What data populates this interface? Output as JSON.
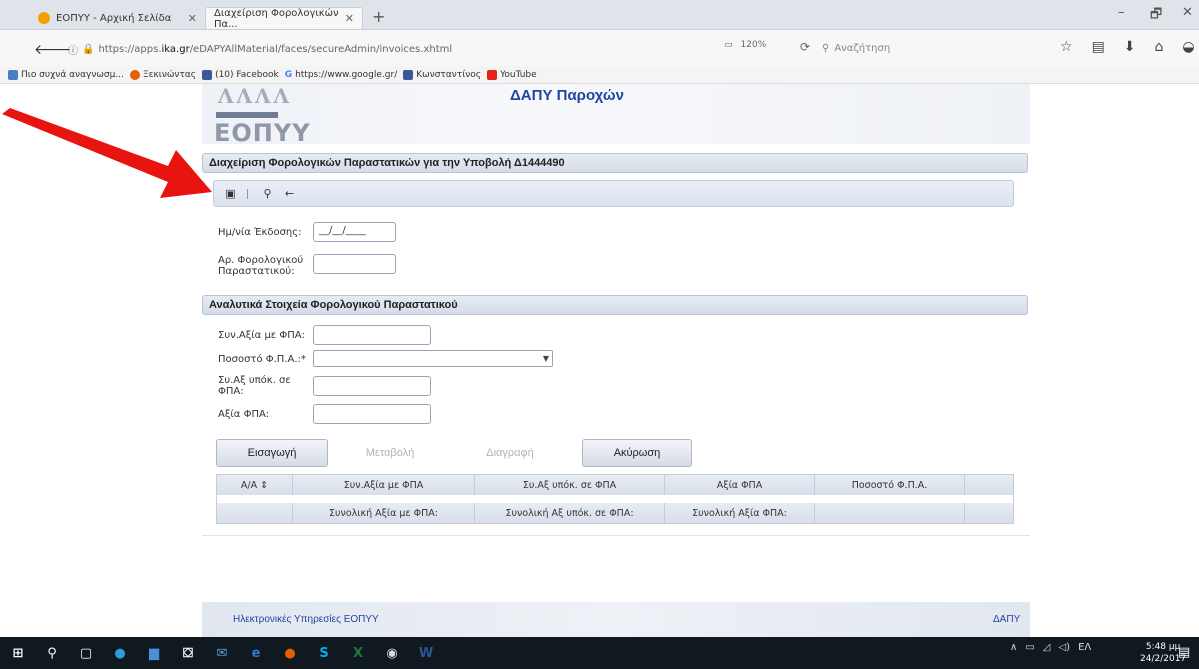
{
  "browser": {
    "tabs": [
      {
        "label": "ΕΟΠΥΥ - Αρχική Σελίδα",
        "active": false
      },
      {
        "label": "Διαχείριση Φορολογικών Πα...",
        "active": true
      }
    ],
    "new_tab": "+",
    "window_controls": {
      "minimize": "–",
      "maximize": "🗗",
      "close": "✕"
    },
    "url_prefix": "https://apps.",
    "url_host": "ika.gr",
    "url_path": "/eDAPYAllMaterial/faces/secureAdmin/invoices.xhtml",
    "zoom": "120%",
    "search_placeholder": "Αναζήτηση",
    "bookmarks": [
      {
        "label": "Πιο συχνά αναγνωσμ...",
        "icon": "bookmark-icon",
        "color": "#4a7fc1"
      },
      {
        "label": "Ξεκινώντας",
        "icon": "firefox-icon",
        "color": "#e66000"
      },
      {
        "label": "(10) Facebook",
        "icon": "facebook-icon",
        "color": "#3b5998"
      },
      {
        "label": "https://www.google.gr/",
        "icon": "google-icon",
        "color": "#4285f4"
      },
      {
        "label": "Κωνσταντίνος",
        "icon": "facebook-icon",
        "color": "#3b5998"
      },
      {
        "label": "YouTube",
        "icon": "youtube-icon",
        "color": "#e62117"
      }
    ]
  },
  "header": {
    "logo_text": "ΕΟΠΥΥ",
    "logo_lines": "ΛΛΛΛ",
    "title": "ΔΑΠΥ Παροχών"
  },
  "section1": {
    "title": "Διαχείριση Φορολογικών Παραστατικών για την Υποβολή Δ1444490",
    "toolbar_icons": [
      "save-icon",
      "separator-icon",
      "search-icon",
      "back-arrow-icon"
    ],
    "issue_date_label": "Ημ/νία Έκδοσης:",
    "issue_date_value": "__/__/____",
    "doc_number_label_1": "Αρ. Φορολογικού",
    "doc_number_label_2": "Παραστατικού:"
  },
  "section2": {
    "title": "Αναλυτικά Στοιχεία Φορολογικού Παραστατικού",
    "total_label": "Συν.Αξία με ΦΠΑ:",
    "vat_percent_label": "Ποσοστό Φ.Π.Α.:*",
    "taxable_label_1": "Συ.Αξ υπόκ. σε",
    "taxable_label_2": "ΦΠΑ:",
    "vat_value_label": "Αξία ΦΠΑ:"
  },
  "buttons": {
    "insert": "Εισαγωγή",
    "modify": "Μεταβολή",
    "delete": "Διαγραφή",
    "cancel": "Ακύρωση"
  },
  "grid": {
    "columns": [
      "Α/Α ⇕",
      "Συν.Αξία με ΦΠΑ",
      "Συ.Αξ υπόκ. σε ΦΠΑ",
      "Αξία ΦΠΑ",
      "Ποσοστό Φ.Π.Α.",
      ""
    ],
    "footer": [
      "",
      "Συνολική Αξία με ΦΠΑ:",
      "Συνολική Αξ υπόκ. σε ΦΠΑ:",
      "Συνολική Αξία ΦΠΑ:",
      "",
      ""
    ]
  },
  "footer": {
    "left": "Ηλεκτρονικές Υπηρεσίες ΕΟΠΥΥ",
    "right": "ΔΑΠΥ"
  },
  "taskbar": {
    "language": "ΕΛ",
    "time": "5:48 μμ",
    "date": "24/2/2017"
  },
  "colors": {
    "accent": "#2243a0",
    "annotation_arrow": "#e8140f"
  }
}
